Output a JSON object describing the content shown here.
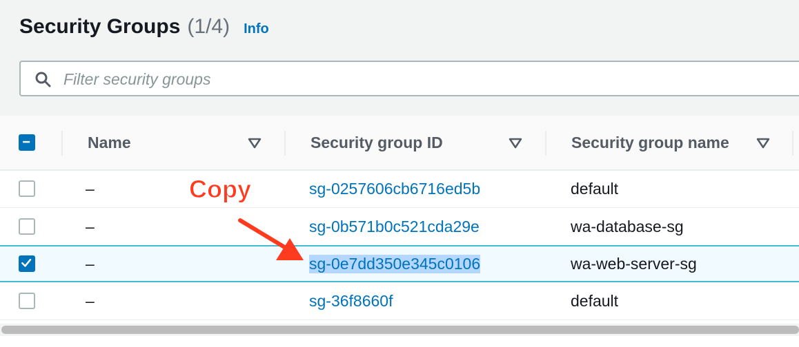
{
  "header": {
    "title": "Security Groups",
    "count": "(1/4)",
    "info_label": "Info"
  },
  "search": {
    "placeholder": "Filter security groups",
    "value": ""
  },
  "table": {
    "columns": [
      "Name",
      "Security group ID",
      "Security group name"
    ],
    "header_checkbox": "indeterminate",
    "rows": [
      {
        "selected": false,
        "name": "–",
        "id": "sg-0257606cb6716ed5b",
        "group_name": "default"
      },
      {
        "selected": false,
        "name": "–",
        "id": "sg-0b571b0c521cda29e",
        "group_name": "wa-database-sg"
      },
      {
        "selected": true,
        "name": "–",
        "id": "sg-0e7dd350e345c0106",
        "group_name": "wa-web-server-sg"
      },
      {
        "selected": false,
        "name": "–",
        "id": "sg-36f8660f",
        "group_name": "default"
      }
    ]
  },
  "annotation": {
    "text": "Copy",
    "color": "#ff3b1f"
  },
  "colors": {
    "link": "#0073bb",
    "accent": "#0073bb",
    "selected_row_border": "#44b9d6",
    "selection_highlight": "#b4d7ff"
  }
}
